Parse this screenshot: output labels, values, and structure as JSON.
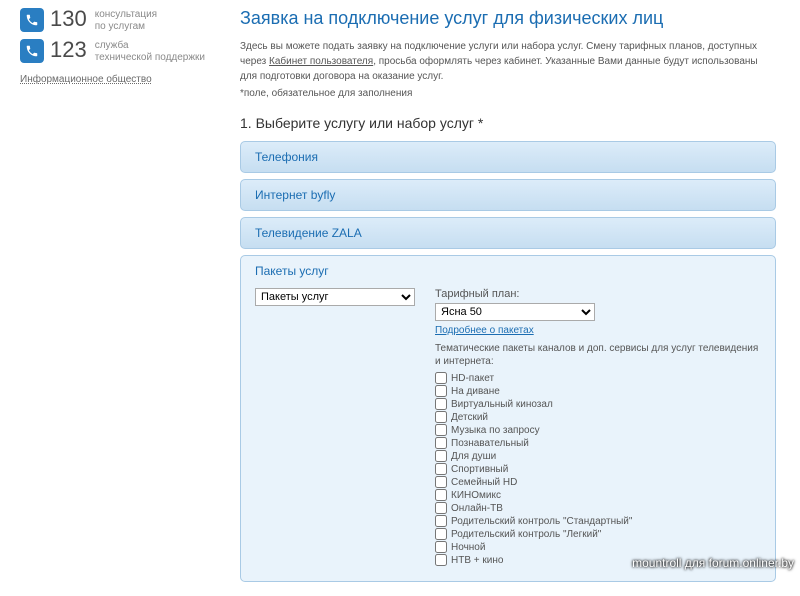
{
  "sidebar": {
    "phones": [
      {
        "number": "130",
        "desc": "консультация\nпо услугам"
      },
      {
        "number": "123",
        "desc": "служба\nтехнической поддержки"
      }
    ],
    "info_link": "Информационное общество"
  },
  "page": {
    "title": "Заявка на подключение услуг для физических лиц",
    "intro_pre": "Здесь вы можете подать заявку на подключение услуги или набора услуг. Смену тарифных планов, доступных через ",
    "intro_link": "Кабинет пользователя",
    "intro_post": ", просьба оформлять через кабинет. Указанные Вами данные будут использованы для подготовки договора на оказание услуг.",
    "required_note": "*поле, обязательное для заполнения",
    "step1": "1. Выберите услугу или набор услуг *"
  },
  "accordions": [
    {
      "title": "Телефония"
    },
    {
      "title": "Интернет byfly"
    },
    {
      "title": "Телевидение ZALA"
    },
    {
      "title": "Пакеты услуг"
    }
  ],
  "packages": {
    "select_package_label": "",
    "select_package_value": "Пакеты услуг",
    "tariff_label": "Тарифный план:",
    "tariff_value": "Ясна 50",
    "more_link": "Подробнее о пакетах",
    "theme_desc": "Тематические пакеты каналов и доп. сервисы для услуг телевидения и интернета:",
    "options": [
      "HD-пакет",
      "На диване",
      "Виртуальный кинозал",
      "Детский",
      "Музыка по запросу",
      "Познавательный",
      "Для души",
      "Спортивный",
      "Семейный HD",
      "КИНОмикс",
      "Онлайн-ТВ",
      "Родительский контроль \"Стандартный\"",
      "Родительский контроль \"Легкий\"",
      "Ночной",
      "НТВ + кино"
    ]
  },
  "watermark": "mountroll для forum.onliner.by"
}
